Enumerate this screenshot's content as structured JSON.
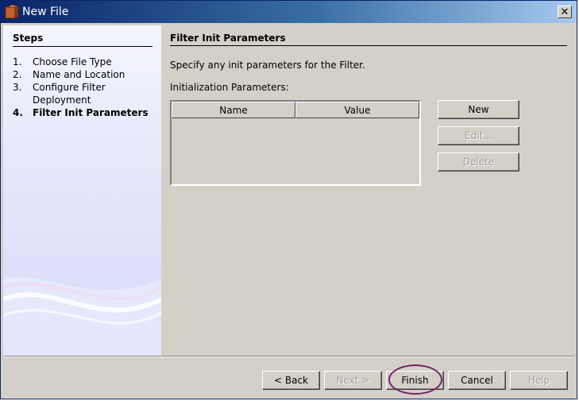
{
  "window": {
    "title": "New File",
    "close_glyph": "✕"
  },
  "steps": {
    "title": "Steps",
    "items": [
      {
        "num": "1.",
        "label": "Choose File Type",
        "current": false
      },
      {
        "num": "2.",
        "label": "Name and Location",
        "current": false
      },
      {
        "num": "3.",
        "label": "Configure Filter Deployment",
        "current": false
      },
      {
        "num": "4.",
        "label": "Filter Init Parameters",
        "current": true
      }
    ]
  },
  "panel": {
    "title": "Filter Init Parameters",
    "description": "Specify any init parameters for the Filter.",
    "table_label": "Initialization Parameters:",
    "columns": [
      "Name",
      "Value"
    ],
    "rows": []
  },
  "buttons": {
    "new": "New",
    "edit": "Edit...",
    "delete": "Delete",
    "back": "< Back",
    "next": "Next >",
    "finish": "Finish",
    "cancel": "Cancel",
    "help": "Help"
  },
  "icons": {
    "app": "netbeans-file-icon",
    "close": "close-icon"
  },
  "colors": {
    "titlebar_start": "#0a246a",
    "titlebar_end": "#a6caf0",
    "annotation_ring": "#7a1f6a"
  }
}
